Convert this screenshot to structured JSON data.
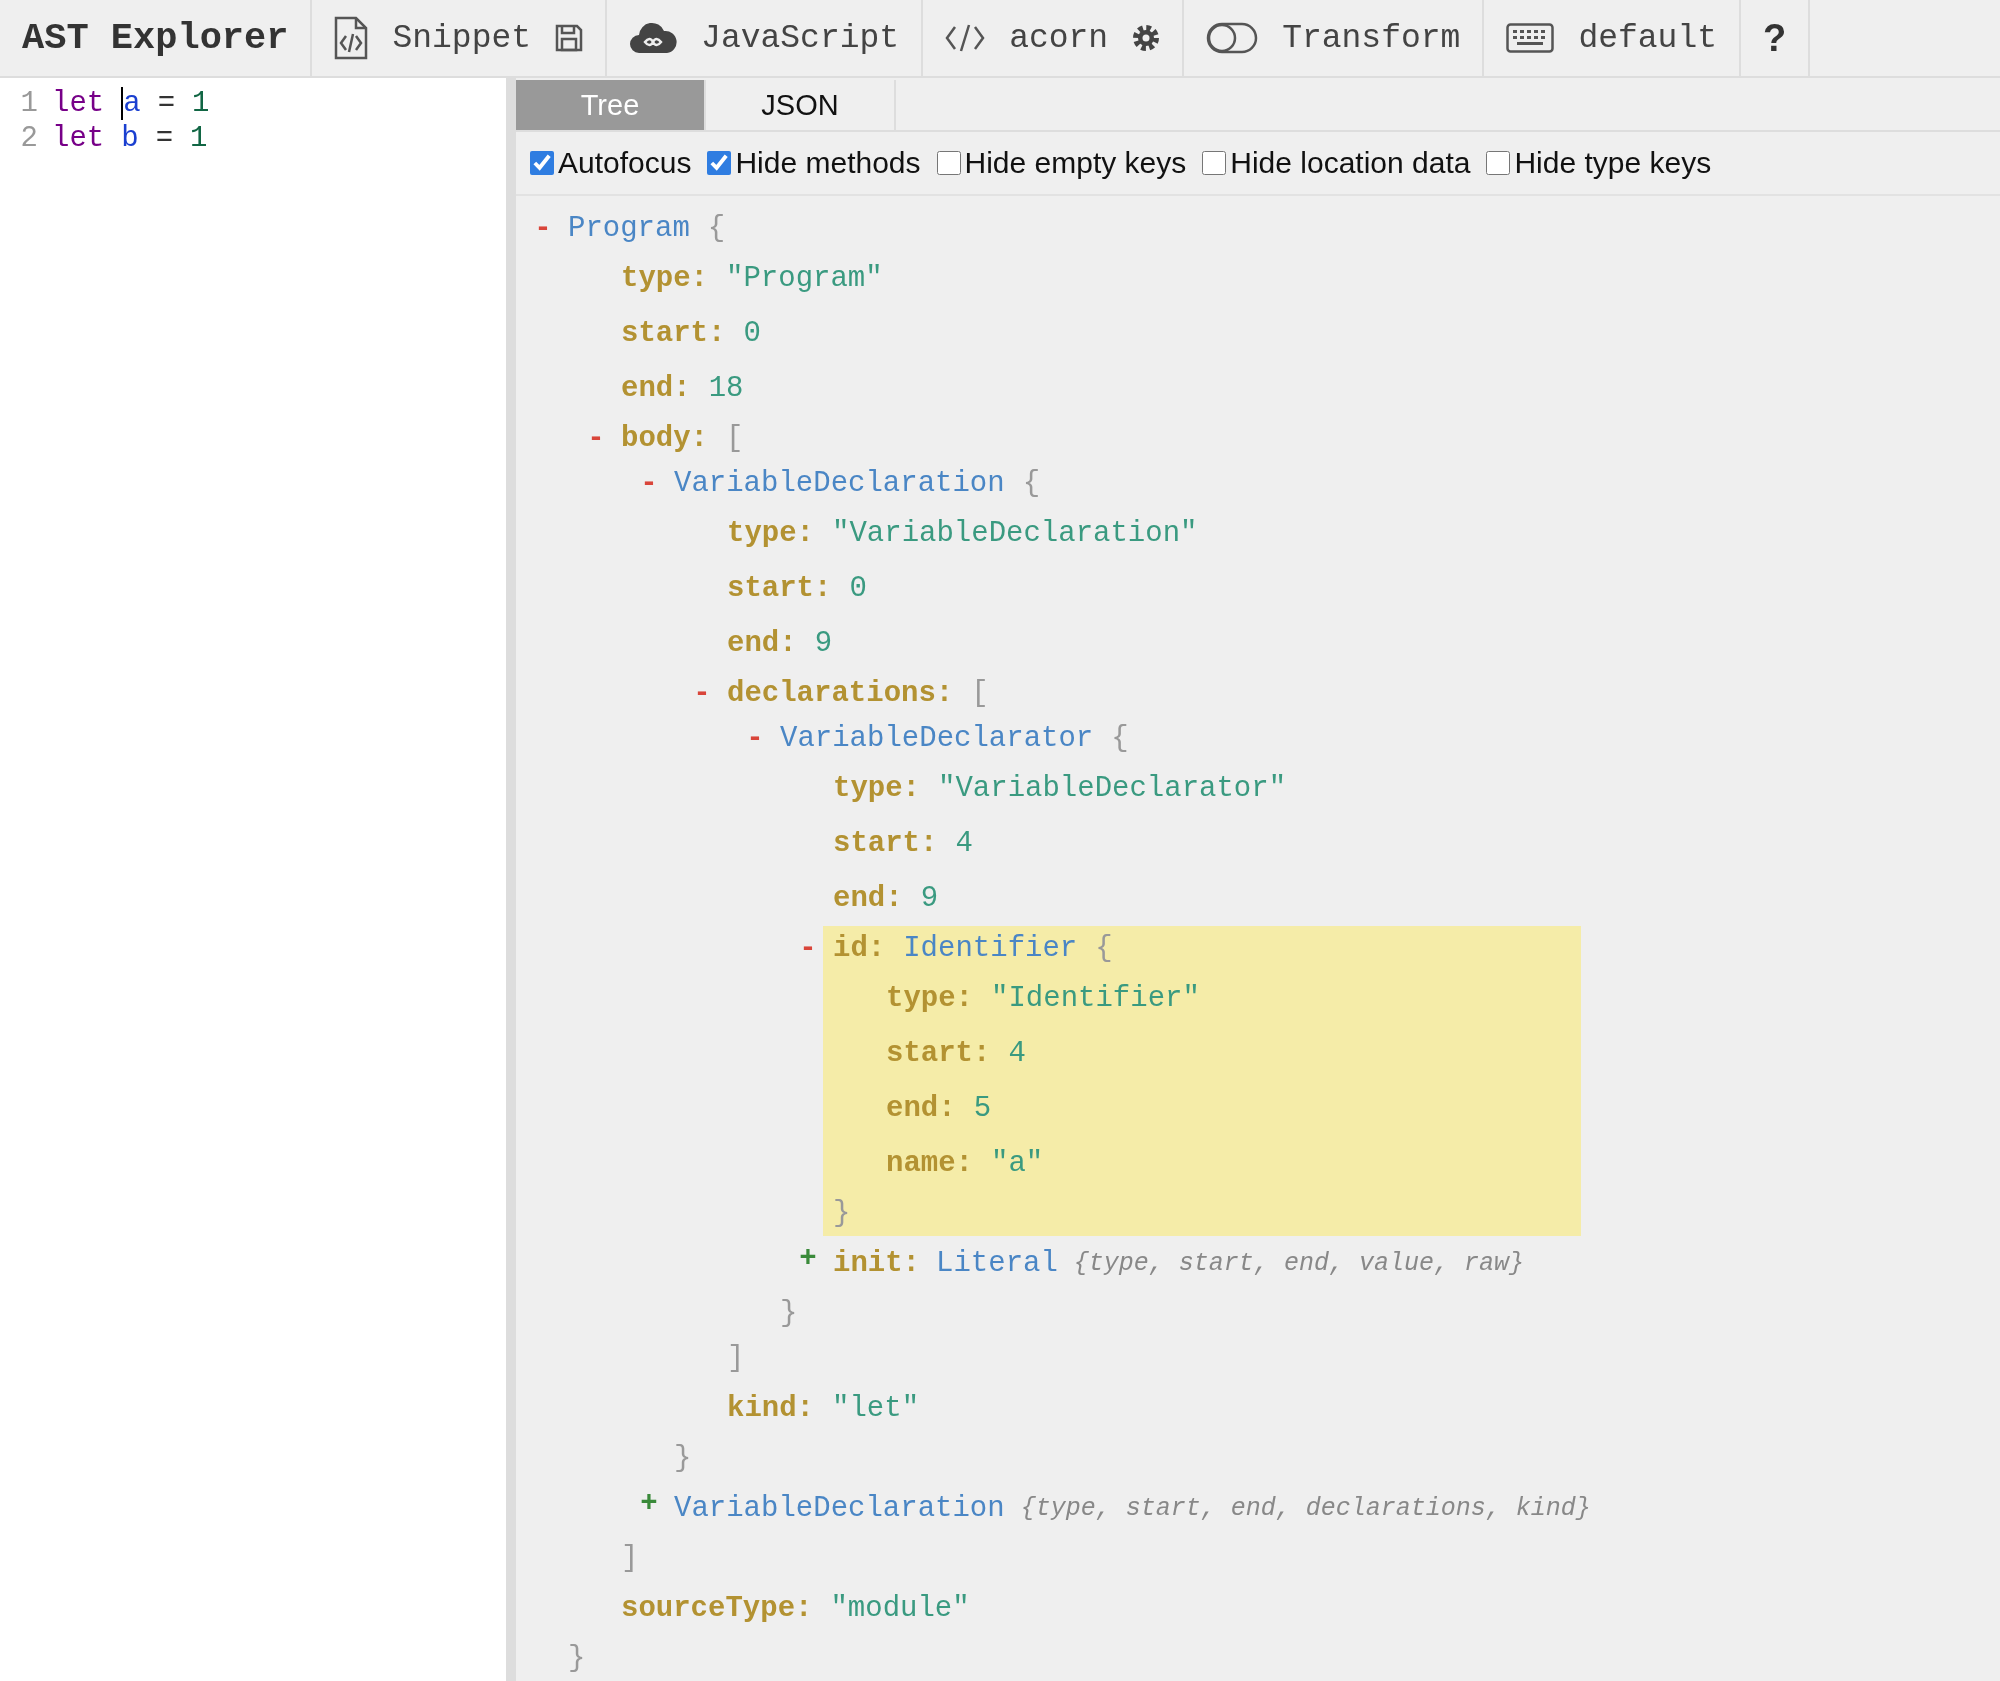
{
  "toolbar": {
    "title": "AST Explorer",
    "snippet": "Snippet",
    "language": "JavaScript",
    "parser": "acorn",
    "transform": "Transform",
    "transform_on": false,
    "keymap": "default",
    "help": "?"
  },
  "editor": {
    "lines": [
      {
        "number": "1",
        "tokens": [
          {
            "kind": "keyword",
            "text": "let"
          },
          {
            "kind": "variable",
            "text": "a",
            "cursor": true
          },
          {
            "kind": "operator",
            "text": "="
          },
          {
            "kind": "number",
            "text": "1"
          }
        ]
      },
      {
        "number": "2",
        "tokens": [
          {
            "kind": "keyword",
            "text": "let"
          },
          {
            "kind": "variable",
            "text": "b",
            "cursor": false
          },
          {
            "kind": "operator",
            "text": "="
          },
          {
            "kind": "number",
            "text": "1"
          }
        ]
      }
    ]
  },
  "tabs": [
    {
      "label": "Tree",
      "selected": true
    },
    {
      "label": "JSON",
      "selected": false
    }
  ],
  "options": [
    {
      "label": "Autofocus",
      "checked": true
    },
    {
      "label": "Hide methods",
      "checked": true
    },
    {
      "label": "Hide empty keys",
      "checked": false
    },
    {
      "label": "Hide location data",
      "checked": false
    },
    {
      "label": "Hide type keys",
      "checked": false
    }
  ],
  "tree": {
    "kind": "object",
    "toggle": "-",
    "expanded": true,
    "type_name": "Program",
    "open": "{",
    "close": "}",
    "children": [
      {
        "kind": "value",
        "key": "type:",
        "value": "\"Program\""
      },
      {
        "kind": "value",
        "key": "start:",
        "value": "0"
      },
      {
        "kind": "value",
        "key": "end:",
        "value": "18"
      },
      {
        "kind": "object",
        "toggle": "-",
        "expanded": true,
        "key": "body:",
        "open": "[",
        "close": "]",
        "children": [
          {
            "kind": "object",
            "toggle": "-",
            "expanded": true,
            "type_name": "VariableDeclaration",
            "open": "{",
            "close": "}",
            "children": [
              {
                "kind": "value",
                "key": "type:",
                "value": "\"VariableDeclaration\""
              },
              {
                "kind": "value",
                "key": "start:",
                "value": "0"
              },
              {
                "kind": "value",
                "key": "end:",
                "value": "9"
              },
              {
                "kind": "object",
                "toggle": "-",
                "expanded": true,
                "key": "declarations:",
                "open": "[",
                "close": "]",
                "children": [
                  {
                    "kind": "object",
                    "toggle": "-",
                    "expanded": true,
                    "type_name": "VariableDeclarator",
                    "open": "{",
                    "close": "}",
                    "children": [
                      {
                        "kind": "value",
                        "key": "type:",
                        "value": "\"VariableDeclarator\""
                      },
                      {
                        "kind": "value",
                        "key": "start:",
                        "value": "4"
                      },
                      {
                        "kind": "value",
                        "key": "end:",
                        "value": "9"
                      },
                      {
                        "kind": "object",
                        "toggle": "-",
                        "expanded": true,
                        "key": "id:",
                        "type_name": "Identifier",
                        "open": "{",
                        "close": "}",
                        "highlighted": true,
                        "children": [
                          {
                            "kind": "value",
                            "key": "type:",
                            "value": "\"Identifier\""
                          },
                          {
                            "kind": "value",
                            "key": "start:",
                            "value": "4"
                          },
                          {
                            "kind": "value",
                            "key": "end:",
                            "value": "5"
                          },
                          {
                            "kind": "value",
                            "key": "name:",
                            "value": "\"a\""
                          }
                        ]
                      },
                      {
                        "kind": "object",
                        "toggle": "+",
                        "expanded": false,
                        "key": "init:",
                        "type_name": "Literal",
                        "summary": "{type, start, end, value, raw}"
                      }
                    ]
                  }
                ]
              },
              {
                "kind": "value",
                "key": "kind:",
                "value": "\"let\""
              }
            ]
          },
          {
            "kind": "object",
            "toggle": "+",
            "expanded": false,
            "type_name": "VariableDeclaration",
            "summary": "{type, start, end, declarations, kind}"
          }
        ]
      },
      {
        "kind": "value",
        "key": "sourceType:",
        "value": "\"module\""
      }
    ]
  }
}
